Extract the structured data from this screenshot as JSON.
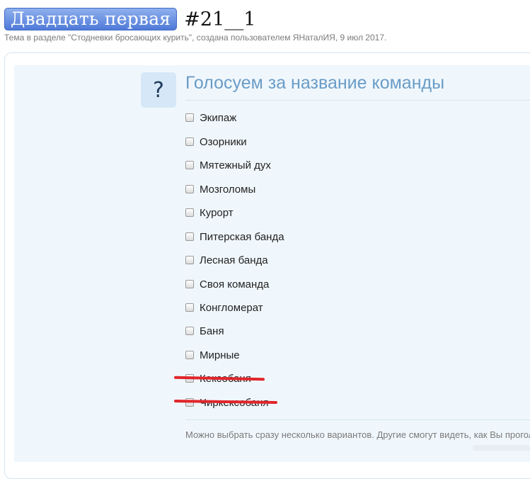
{
  "thread": {
    "prefix": "Двадцать первая",
    "title": "#21__1",
    "meta": "Тема в разделе \"Стодневки бросающих курить\", создана пользователем ЯНаталИЯ, 9 июл 2017."
  },
  "poll": {
    "question_icon": "?",
    "title": "Голосуем за название команды",
    "options": [
      {
        "label": "Экипаж"
      },
      {
        "label": "Озорники"
      },
      {
        "label": "Мятежный дух"
      },
      {
        "label": "Мозголомы"
      },
      {
        "label": "Курорт"
      },
      {
        "label": "Питерская банда"
      },
      {
        "label": "Лесная банда"
      },
      {
        "label": "Своя команда"
      },
      {
        "label": "Конгломерат"
      },
      {
        "label": "Баня"
      },
      {
        "label": "Мирные"
      },
      {
        "label": "Кексобаня"
      },
      {
        "label": "Чиркексобаня"
      }
    ],
    "hint": "Можно выбрать сразу несколько вариантов. Другие смогут видеть, как Вы проголосовали."
  },
  "colors": {
    "prefix_blue": "#5a84de",
    "poll_title": "#6a9cc7",
    "strike_red": "#e0262b"
  }
}
